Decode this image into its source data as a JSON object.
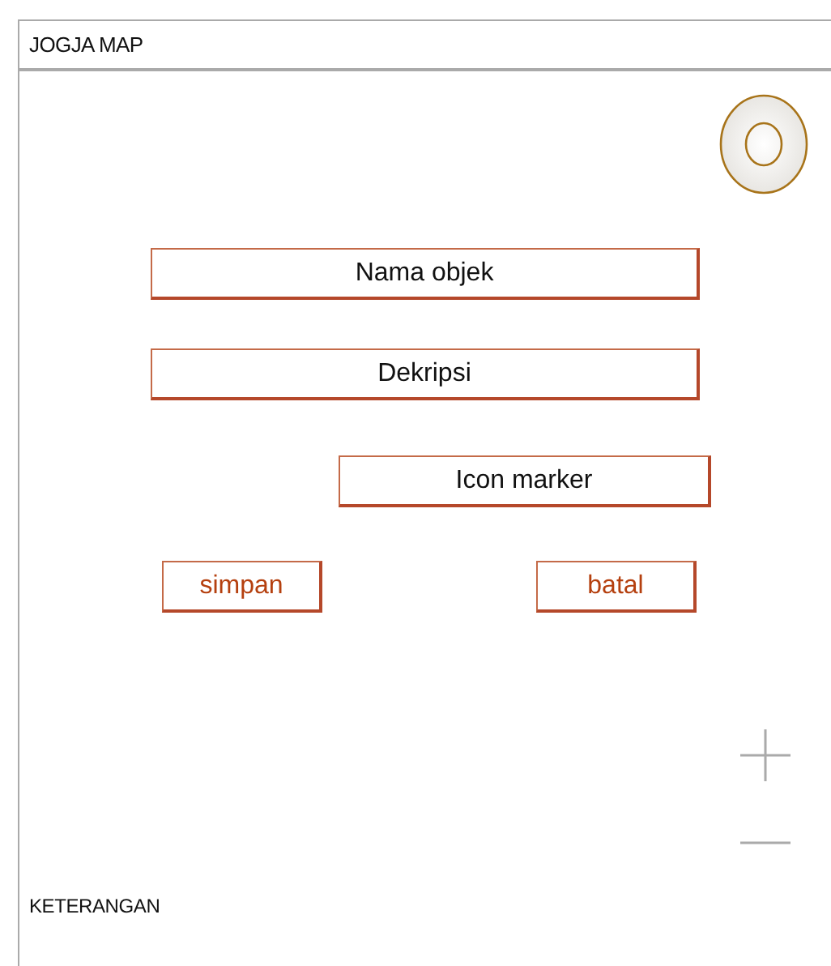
{
  "header": {
    "title": "JOGJA MAP"
  },
  "form": {
    "fields": [
      {
        "placeholder": "Nama objek"
      },
      {
        "placeholder": "Dekripsi"
      },
      {
        "placeholder": "Icon marker"
      }
    ],
    "buttons": [
      "simpan",
      "batal"
    ]
  },
  "footer": {
    "label": "KETERANGAN"
  }
}
